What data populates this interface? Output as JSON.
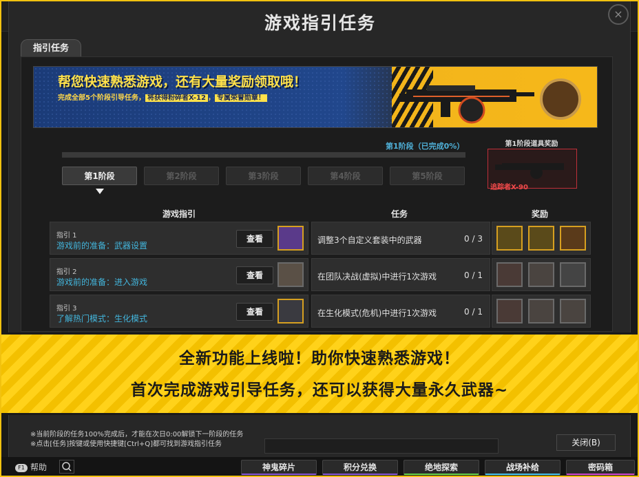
{
  "window": {
    "title": "游戏指引任务",
    "close_icon": "×"
  },
  "tab": {
    "label": "指引任务"
  },
  "banner": {
    "title": "帮您快速熟悉游戏，还有大量奖励领取哦！",
    "sub_prefix": "完成全部5个阶段引导任务，",
    "sub_highlight1": "将获得粉碎者X-12",
    "sub_mid": "，",
    "sub_highlight2": "专属荣誉勋章！"
  },
  "stage_progress": {
    "label": "第1阶段（已完成0%）",
    "value": 0
  },
  "stage_reward": {
    "title": "第1阶段道具奖励",
    "item_name": "追踪者X-90"
  },
  "stages": [
    "第1阶段",
    "第2阶段",
    "第3阶段",
    "第4阶段",
    "第5阶段"
  ],
  "table": {
    "headers": {
      "guide": "游戏指引",
      "task": "任务",
      "reward": "奖励"
    },
    "view_label": "查看",
    "rows": [
      {
        "num": "指引 1",
        "title": "游戏前的准备：武器设置",
        "task": "调整3个自定义套装中的武器",
        "count": "0 / 3"
      },
      {
        "num": "指引 2",
        "title": "游戏前的准备：进入游戏",
        "task": "在团队决战(虚拟)中进行1次游戏",
        "count": "0 / 1"
      },
      {
        "num": "指引 3",
        "title": "了解热门模式：生化模式",
        "task": "在生化模式(危机)中进行1次游戏",
        "count": "0 / 1"
      }
    ]
  },
  "promo": {
    "line1": "全新功能上线啦！助你快速熟悉游戏！",
    "line2": "首次完成游戏引导任务，还可以获得大量永久武器~"
  },
  "notes": [
    "※当前阶段的任务100%完成后，才能在次日0:00解锁下一阶段的任务",
    "※点击[任务]按键或使用快捷键[Ctrl+Q]都可找到游戏指引任务"
  ],
  "close_button": "关闭(B)",
  "help": {
    "key": "F1",
    "label": "帮助"
  },
  "bottom_buttons": [
    "神鬼碎片",
    "积分兑换",
    "绝地探索",
    "战场补给",
    "密码箱"
  ],
  "colors": {
    "accent_yellow": "#f2c20f",
    "guide_title_blue": "#43b5dc",
    "reward_red": "#f04a4a"
  }
}
